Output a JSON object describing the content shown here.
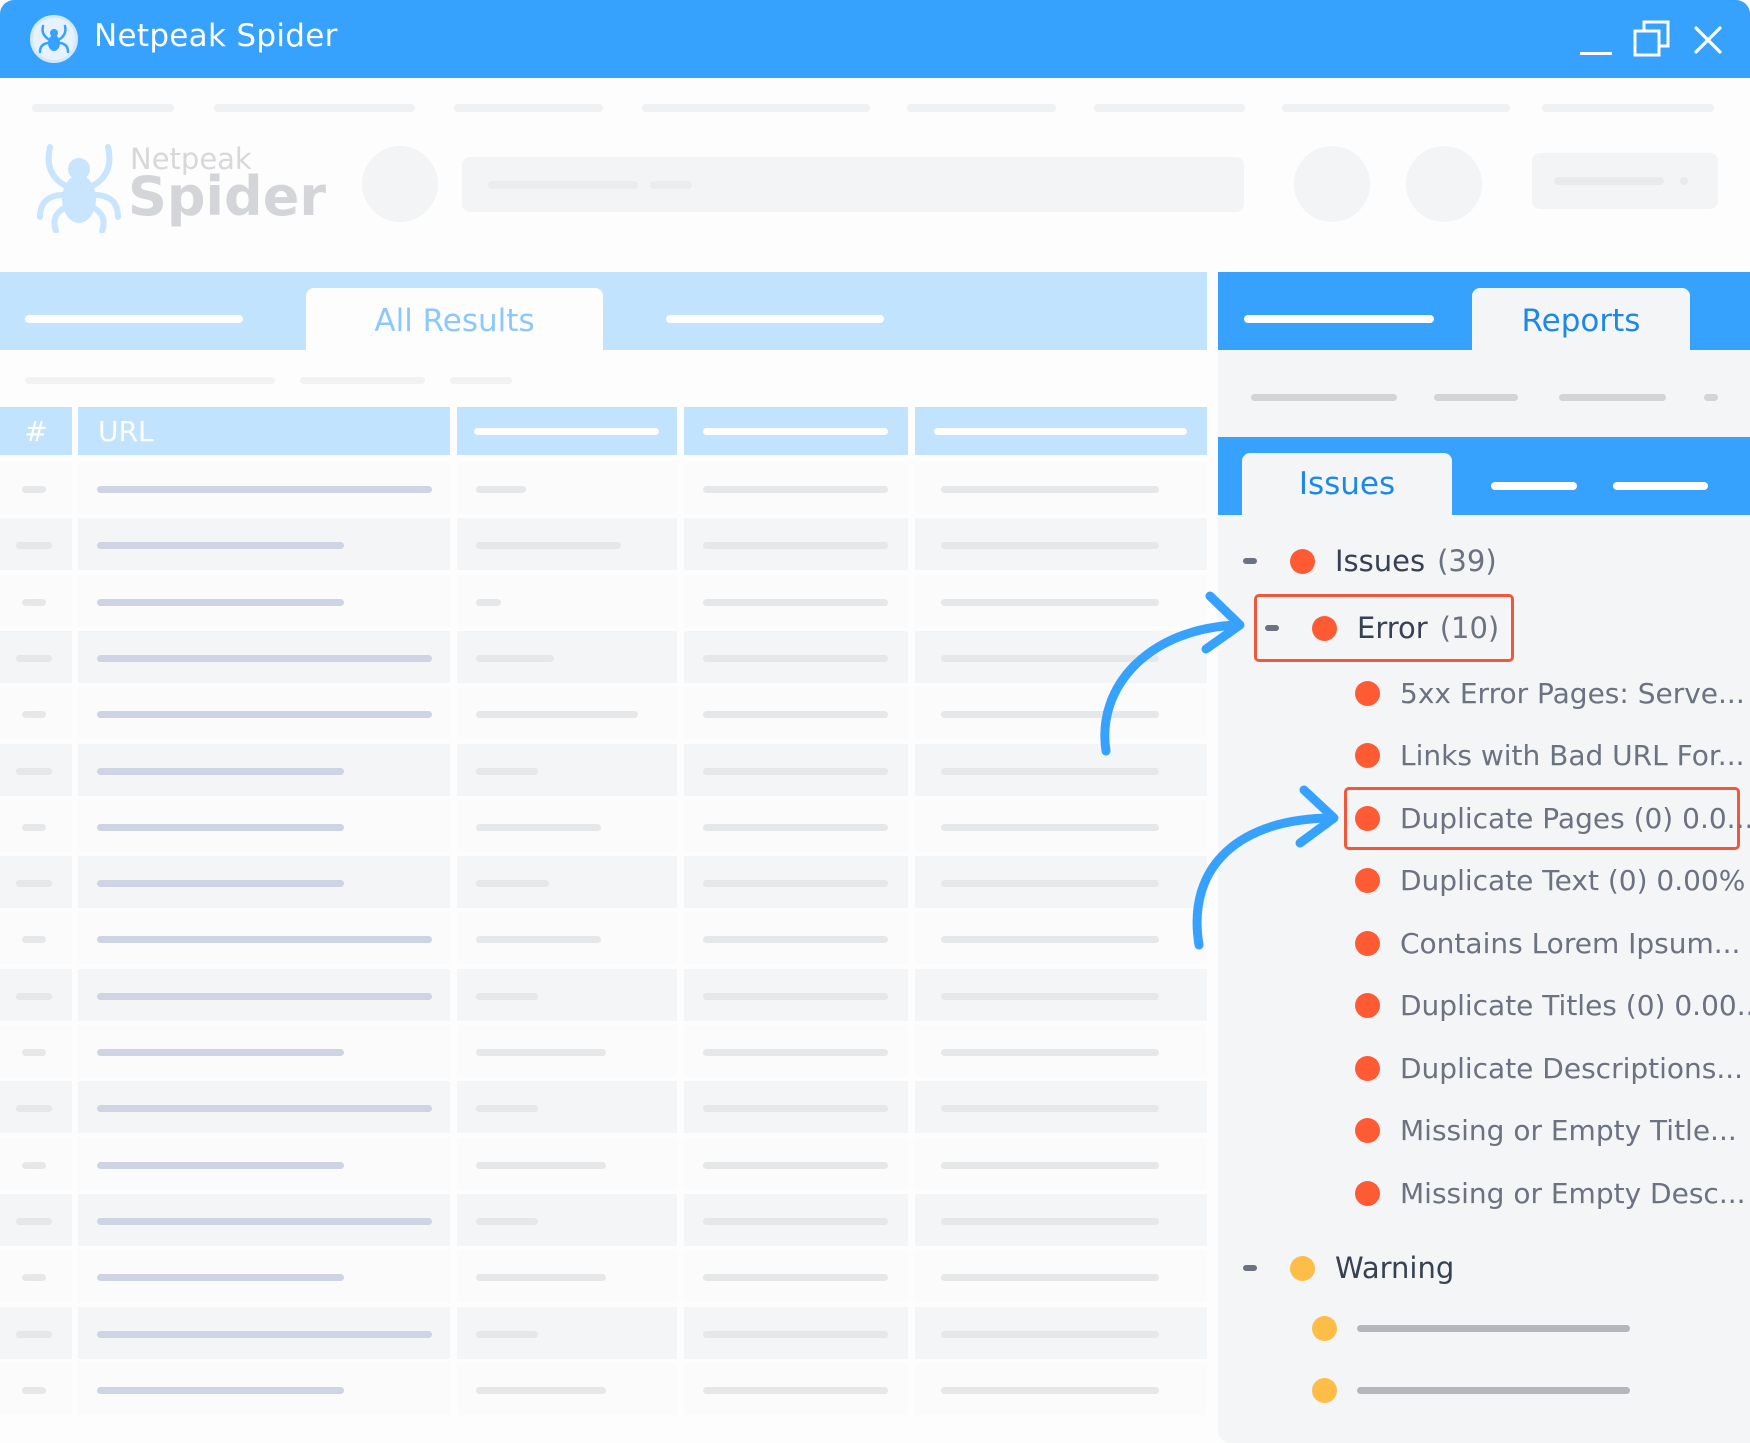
{
  "window": {
    "title": "Netpeak Spider",
    "controls": [
      {
        "name": "minimize",
        "icon": "minimize-icon"
      },
      {
        "name": "restore",
        "icon": "restore-icon"
      },
      {
        "name": "close",
        "icon": "close-icon"
      }
    ]
  },
  "brand": {
    "line1": "Netpeak",
    "line2": "Spider",
    "icon": "spider-logo-icon"
  },
  "left_panel": {
    "active_tab": "All Results",
    "table": {
      "headers": [
        "#",
        "URL"
      ],
      "row_count": 17
    }
  },
  "right_panel": {
    "active_tab": "Reports",
    "sub_active_tab": "Issues",
    "tree": {
      "root": {
        "label": "Issues",
        "count": "(39)",
        "status": "error"
      },
      "error_group": {
        "label": "Error",
        "count": "(10)",
        "status": "error",
        "highlighted": true
      },
      "error_items": [
        {
          "label": "5xx Error Pages: Serve...",
          "highlighted": false
        },
        {
          "label": "Links with Bad URL For...",
          "highlighted": false
        },
        {
          "label": "Duplicate Pages (0) 0.0...",
          "highlighted": true
        },
        {
          "label": "Duplicate Text (0) 0.00%",
          "highlighted": false
        },
        {
          "label": "Contains Lorem Ipsum...",
          "highlighted": false
        },
        {
          "label": "Duplicate Titles (0) 0.00...",
          "highlighted": false
        },
        {
          "label": "Duplicate Descriptions...",
          "highlighted": false
        },
        {
          "label": "Missing or Empty Title...",
          "highlighted": false
        },
        {
          "label": "Missing or Empty Desc...",
          "highlighted": false
        }
      ],
      "warning_group": {
        "label": "Warning",
        "status": "warning"
      }
    }
  },
  "colors": {
    "brand_blue": "#36a2fd",
    "light_blue": "#c2e3fd",
    "error": "#fe5a34",
    "warning": "#fdbd47",
    "highlight": "#f0573b"
  }
}
